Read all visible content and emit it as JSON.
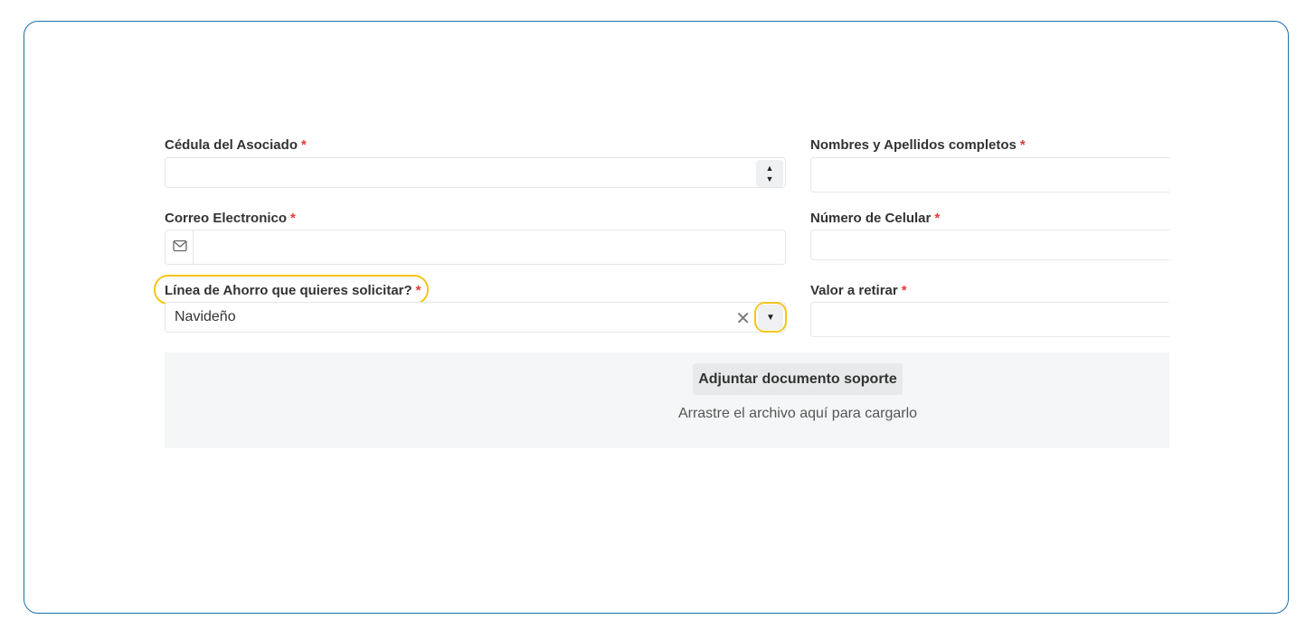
{
  "form": {
    "cedula": {
      "label": "Cédula del Asociado",
      "required": "*",
      "value": ""
    },
    "nombres": {
      "label": "Nombres y Apellidos completos",
      "required": "*",
      "value": ""
    },
    "correo": {
      "label": "Correo Electronico",
      "required": "*",
      "value": "",
      "icon": "mail-icon"
    },
    "celular": {
      "label": "Número de Celular",
      "required": "*",
      "value": ""
    },
    "linea": {
      "label": "Línea de Ahorro que quieres solicitar?",
      "required": "*",
      "selected": "Navideño",
      "clear_glyph": "✕",
      "caret_glyph": "▼"
    },
    "valor": {
      "label": "Valor a retirar",
      "required": "*",
      "value": ""
    }
  },
  "upload": {
    "button_label": "Adjuntar documento soporte",
    "hint": "Arrastre el archivo aquí para cargarlo"
  },
  "colors": {
    "frame_border": "#1b6fa8",
    "highlight": "#f5c518",
    "required": "#e53935"
  }
}
